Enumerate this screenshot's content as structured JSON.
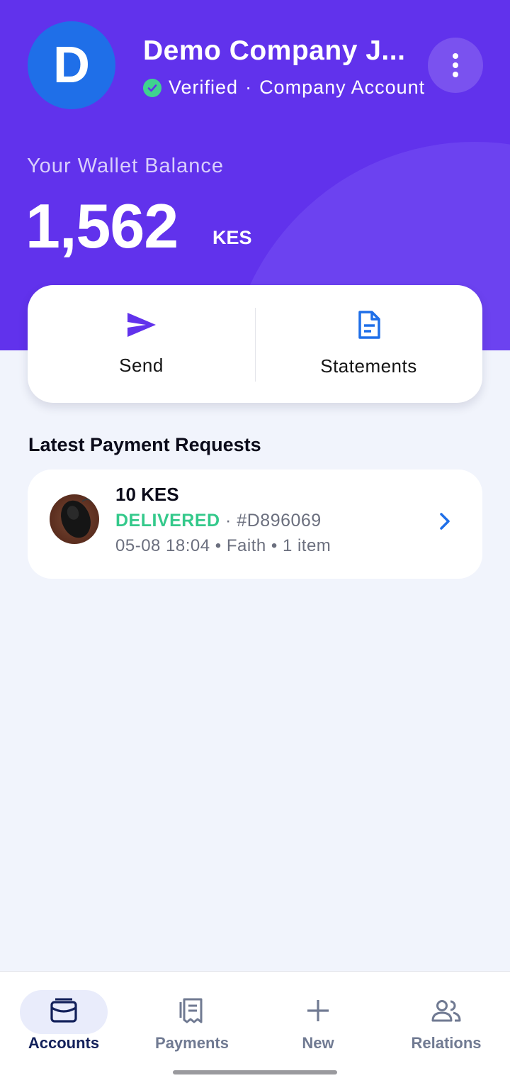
{
  "header": {
    "avatar_letter": "D",
    "company_name": "Demo Company J...",
    "verified_label": "Verified",
    "separator": "·",
    "account_type": "Company Account",
    "menu_icon": "more-vertical-icon"
  },
  "wallet": {
    "label": "Your Wallet Balance",
    "amount": "1,562",
    "currency": "KES"
  },
  "actions": [
    {
      "label": "Send",
      "icon": "send-icon"
    },
    {
      "label": "Statements",
      "icon": "document-icon"
    }
  ],
  "requests": {
    "title": "Latest Payment Requests",
    "items": [
      {
        "amount": "10 KES",
        "status": "DELIVERED",
        "separator": "·",
        "id": "#D896069",
        "meta": "05-08 18:04 • Faith  • 1 item",
        "thumbnail": "product-photo"
      }
    ]
  },
  "nav": {
    "items": [
      {
        "label": "Accounts",
        "icon": "wallet-icon",
        "active": true
      },
      {
        "label": "Payments",
        "icon": "receipt-icon",
        "active": false
      },
      {
        "label": "New",
        "icon": "plus-icon",
        "active": false
      },
      {
        "label": "Relations",
        "icon": "people-icon",
        "active": false
      }
    ]
  },
  "colors": {
    "brand_purple": "#6132ec",
    "verified_green": "#3fd28f",
    "status_delivered": "#34c98b",
    "link_blue": "#1f6fe8",
    "background": "#f1f4fc"
  }
}
